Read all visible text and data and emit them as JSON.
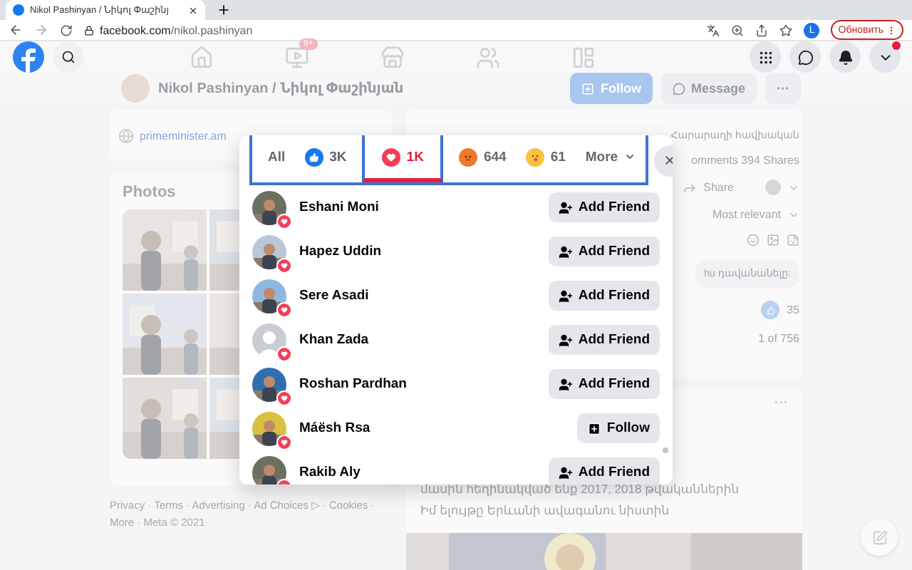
{
  "browser": {
    "tab_title": "Nikol Pashinyan / Նիկոլ Փաշինյ",
    "url_host": "facebook.com",
    "url_path": "/nikol.pashinyan",
    "profile_initial": "L",
    "update_button": "Обновить"
  },
  "header": {
    "nav": [
      {
        "kind": "home"
      },
      {
        "kind": "video",
        "badge": "9+"
      },
      {
        "kind": "store"
      },
      {
        "kind": "groups"
      },
      {
        "kind": "gaming"
      }
    ]
  },
  "profile": {
    "name": "Nikol Pashinyan / Նիկոլ Փաշինյան",
    "follow": "Follow",
    "message": "Message",
    "more": "···"
  },
  "intro": {
    "link": "primeminister.am"
  },
  "photos": {
    "title": "Photos"
  },
  "footer": [
    "Privacy · Terms · Advertising · Ad Choices ▷ · Cookies ·",
    "More · Meta © 2021"
  ],
  "post": {
    "caption": "Հարարաղի հավխական",
    "stats": "omments 394 Shares",
    "share": "Share",
    "sort": "Most relevant",
    "comment": "hu դավանանելը:",
    "likes": "35",
    "pager": "1 of 756"
  },
  "post2": {
    "more": "···",
    "lines": [
      "մասին հեղինակված ենք 2017, 2018 թվականներին",
      "Իմ ելույթը Երևանի ավագանու նիստին"
    ]
  },
  "reactions": {
    "tabs": [
      {
        "kind": "all",
        "label": "All",
        "selected": false
      },
      {
        "kind": "like",
        "label": "3K",
        "selected": false
      },
      {
        "kind": "love",
        "label": "1K",
        "selected": true
      },
      {
        "kind": "angry",
        "label": "644",
        "selected": false
      },
      {
        "kind": "yum",
        "label": "61",
        "selected": false
      },
      {
        "kind": "more",
        "label": "More",
        "selected": false
      }
    ],
    "people": [
      {
        "name": "Eshani Moni",
        "reaction": {
          "kind": "love"
        },
        "button": {
          "kind": "add_friend",
          "label": "Add Friend"
        }
      },
      {
        "name": "Hapez Uddin",
        "reaction": {
          "kind": "love"
        },
        "button": {
          "kind": "add_friend",
          "label": "Add Friend"
        }
      },
      {
        "name": "Sere Asadi",
        "reaction": {
          "kind": "love"
        },
        "button": {
          "kind": "add_friend",
          "label": "Add Friend"
        }
      },
      {
        "name": "Khan Zada",
        "avatar": {
          "kind": "default"
        },
        "reaction": {
          "kind": "love"
        },
        "button": {
          "kind": "add_friend",
          "label": "Add Friend"
        }
      },
      {
        "name": "Roshan Pardhan",
        "reaction": {
          "kind": "love"
        },
        "button": {
          "kind": "add_friend",
          "label": "Add Friend"
        }
      },
      {
        "name": "Máësh Rsa",
        "reaction": {
          "kind": "love"
        },
        "button": {
          "kind": "follow",
          "label": "Follow"
        }
      },
      {
        "name": "Rakib Aly",
        "reaction": {
          "kind": "love"
        },
        "button": {
          "kind": "add_friend",
          "label": "Add Friend"
        }
      }
    ]
  }
}
